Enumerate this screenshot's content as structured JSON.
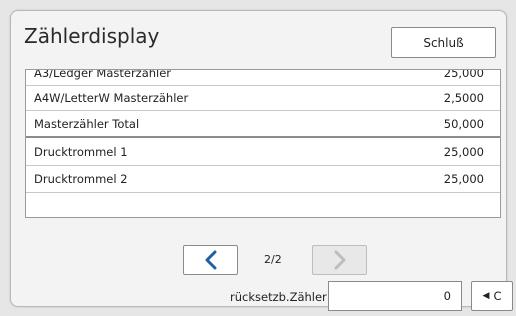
{
  "header": {
    "title": "Zählerdisplay",
    "close_label": "Schluß"
  },
  "rows": [
    {
      "label": "A3/Ledger Masterzähler",
      "value": "25,000"
    },
    {
      "label": "A4W/LetterW Masterzähler",
      "value": "2,5000"
    },
    {
      "label": "Masterzähler Total",
      "value": "50,000"
    },
    {
      "label": "Drucktrommel 1",
      "value": "25,000"
    },
    {
      "label": "Drucktrommel 2",
      "value": "25,000"
    }
  ],
  "pagination": {
    "indicator": "2/2"
  },
  "reset": {
    "label": "rücksetzb.Zähler",
    "value": "0",
    "clear_label": "C"
  },
  "colors": {
    "accent": "#1f5fa8",
    "disabled": "#bdbdbd"
  },
  "icons": {
    "prev": "chevron-left-icon",
    "next": "chevron-right-icon",
    "clear": "triangle-left-icon"
  }
}
